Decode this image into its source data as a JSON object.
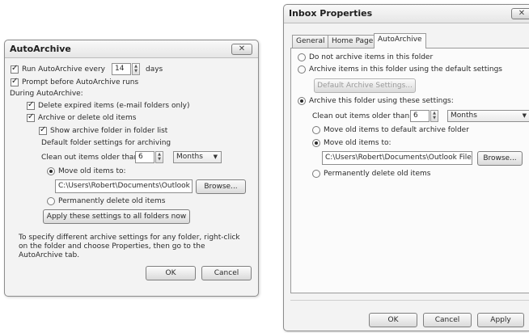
{
  "archive_dialog": {
    "title": "AutoArchive",
    "close_icon": "close-icon",
    "run_label": "Run AutoArchive every",
    "run_value": "14",
    "days_label": "days",
    "prompt_label": "Prompt before AutoArchive runs",
    "during_label": "During AutoArchive:",
    "delete_expired_label": "Delete expired items (e-mail folders only)",
    "archive_old_label": "Archive or delete old items",
    "show_folder_label": "Show archive folder in folder list",
    "default_settings_label": "Default folder settings for archiving",
    "clean_label": "Clean out items older than",
    "clean_value": "6",
    "clean_unit": "Months",
    "move_label": "Move old items to:",
    "move_path": "C:\\Users\\Robert\\Documents\\Outlook F",
    "browse_label": "Browse...",
    "perm_delete_label": "Permanently delete old items",
    "apply_all_label": "Apply these settings to all folders now",
    "info_line1": "To specify different archive settings for any folder, right-click",
    "info_line2": "on the folder and choose Properties, then go to the",
    "info_line3": "AutoArchive tab.",
    "ok_label": "OK",
    "cancel_label": "Cancel"
  },
  "inbox_dialog": {
    "title": "Inbox Properties",
    "close_icon": "close-icon",
    "tabs": [
      "General",
      "Home Page",
      "AutoArchive"
    ],
    "active_tab": "AutoArchive",
    "no_archive_label": "Do not archive items in this folder",
    "default_archive_label": "Archive items in this folder using the default settings",
    "default_archive_btn": "Default Archive Settings...",
    "custom_archive_label": "Archive this folder using these settings:",
    "clean_label": "Clean out items older than",
    "clean_value": "6",
    "clean_unit": "Months",
    "move_default_label": "Move old items to default archive folder",
    "move_label": "Move old items to:",
    "move_path": "C:\\Users\\Robert\\Documents\\Outlook Files\\",
    "browse_label": "Browse...",
    "perm_delete_label": "Permanently delete old items",
    "ok_label": "OK",
    "cancel_label": "Cancel",
    "apply_label": "Apply"
  }
}
